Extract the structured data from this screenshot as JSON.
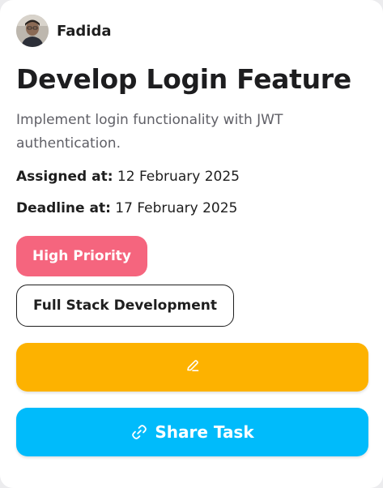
{
  "user": {
    "name": "Fadida"
  },
  "task": {
    "title": "Develop Login Feature",
    "description": "Implement login functionality with JWT authentication.",
    "assigned_label": "Assigned at:",
    "assigned_value": "12 February 2025",
    "deadline_label": "Deadline at:",
    "deadline_value": "17 February 2025",
    "priority": "High Priority",
    "category": "Full Stack Development"
  },
  "actions": {
    "edit_icon": "pencil-icon",
    "share_label": "Share Task",
    "share_icon": "link-icon"
  },
  "colors": {
    "priority_bg": "#f5657e",
    "edit_bg": "#fdb200",
    "share_bg": "#00bbfb"
  }
}
